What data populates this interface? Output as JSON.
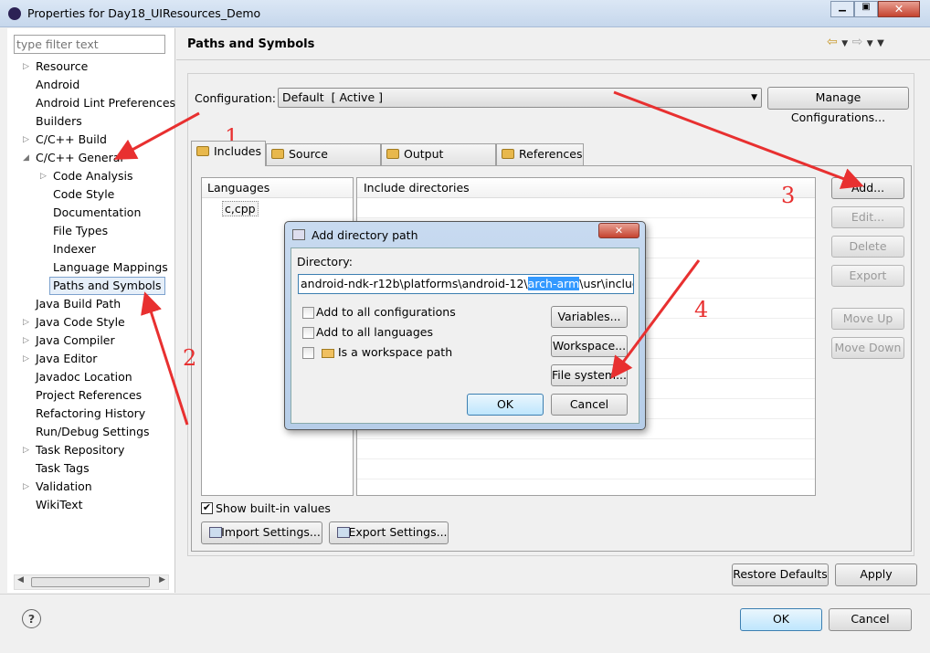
{
  "window": {
    "title": "Properties for Day18_UIResources_Demo"
  },
  "filter": {
    "placeholder": "type filter text"
  },
  "tree": [
    {
      "label": "Resource",
      "expander": "collapsed",
      "indent": 0
    },
    {
      "label": "Android",
      "expander": "none",
      "indent": 0
    },
    {
      "label": "Android Lint Preferences",
      "expander": "none",
      "indent": 0
    },
    {
      "label": "Builders",
      "expander": "none",
      "indent": 0
    },
    {
      "label": "C/C++ Build",
      "expander": "collapsed",
      "indent": 0
    },
    {
      "label": "C/C++ General",
      "expander": "expanded",
      "indent": 0
    },
    {
      "label": "Code Analysis",
      "expander": "collapsed",
      "indent": 1
    },
    {
      "label": "Code Style",
      "expander": "none",
      "indent": 1
    },
    {
      "label": "Documentation",
      "expander": "none",
      "indent": 1
    },
    {
      "label": "File Types",
      "expander": "none",
      "indent": 1
    },
    {
      "label": "Indexer",
      "expander": "none",
      "indent": 1
    },
    {
      "label": "Language Mappings",
      "expander": "none",
      "indent": 1
    },
    {
      "label": "Paths and Symbols",
      "expander": "none",
      "indent": 1,
      "selected": true
    },
    {
      "label": "Java Build Path",
      "expander": "none",
      "indent": 0
    },
    {
      "label": "Java Code Style",
      "expander": "collapsed",
      "indent": 0
    },
    {
      "label": "Java Compiler",
      "expander": "collapsed",
      "indent": 0
    },
    {
      "label": "Java Editor",
      "expander": "collapsed",
      "indent": 0
    },
    {
      "label": "Javadoc Location",
      "expander": "none",
      "indent": 0
    },
    {
      "label": "Project References",
      "expander": "none",
      "indent": 0
    },
    {
      "label": "Refactoring History",
      "expander": "none",
      "indent": 0
    },
    {
      "label": "Run/Debug Settings",
      "expander": "none",
      "indent": 0
    },
    {
      "label": "Task Repository",
      "expander": "collapsed",
      "indent": 0
    },
    {
      "label": "Task Tags",
      "expander": "none",
      "indent": 0
    },
    {
      "label": "Validation",
      "expander": "collapsed",
      "indent": 0
    },
    {
      "label": "WikiText",
      "expander": "none",
      "indent": 0
    }
  ],
  "page": {
    "title": "Paths and Symbols",
    "config_label": "Configuration:",
    "config_value": "Default  [ Active ]",
    "manage": "Manage Configurations..."
  },
  "tabs": [
    "Includes",
    "Source Location",
    "Output Location",
    "References"
  ],
  "languages": {
    "header": "Languages",
    "items": [
      "c,cpp"
    ]
  },
  "includes": {
    "header": "Include directories"
  },
  "side_buttons": [
    {
      "label": "Add...",
      "enabled": true
    },
    {
      "label": "Edit...",
      "enabled": false
    },
    {
      "label": "Delete",
      "enabled": false
    },
    {
      "label": "Export",
      "enabled": false
    },
    {
      "label": "Move Up",
      "enabled": false
    },
    {
      "label": "Move Down",
      "enabled": false
    }
  ],
  "show_builtin": "Show built-in values",
  "import": "Import Settings...",
  "export": "Export Settings...",
  "restore": "Restore Defaults",
  "apply": "Apply",
  "ok": "OK",
  "cancel": "Cancel",
  "dialog": {
    "title": "Add directory path",
    "dir_label": "Directory:",
    "dir_before": "android-ndk-r12b\\platforms\\android-12\\",
    "dir_selected": "arch-arm",
    "dir_after": "\\usr\\include",
    "cb1": "Add to all configurations",
    "cb2": "Add to all languages",
    "cb3": "Is a workspace path",
    "variables": "Variables...",
    "workspace": "Workspace...",
    "filesystem": "File system...",
    "ok": "OK",
    "cancel": "Cancel"
  },
  "annotations": [
    "1",
    "2",
    "3",
    "4"
  ],
  "colors": {
    "selection": "#3399ff",
    "annotation": "#e83030"
  }
}
